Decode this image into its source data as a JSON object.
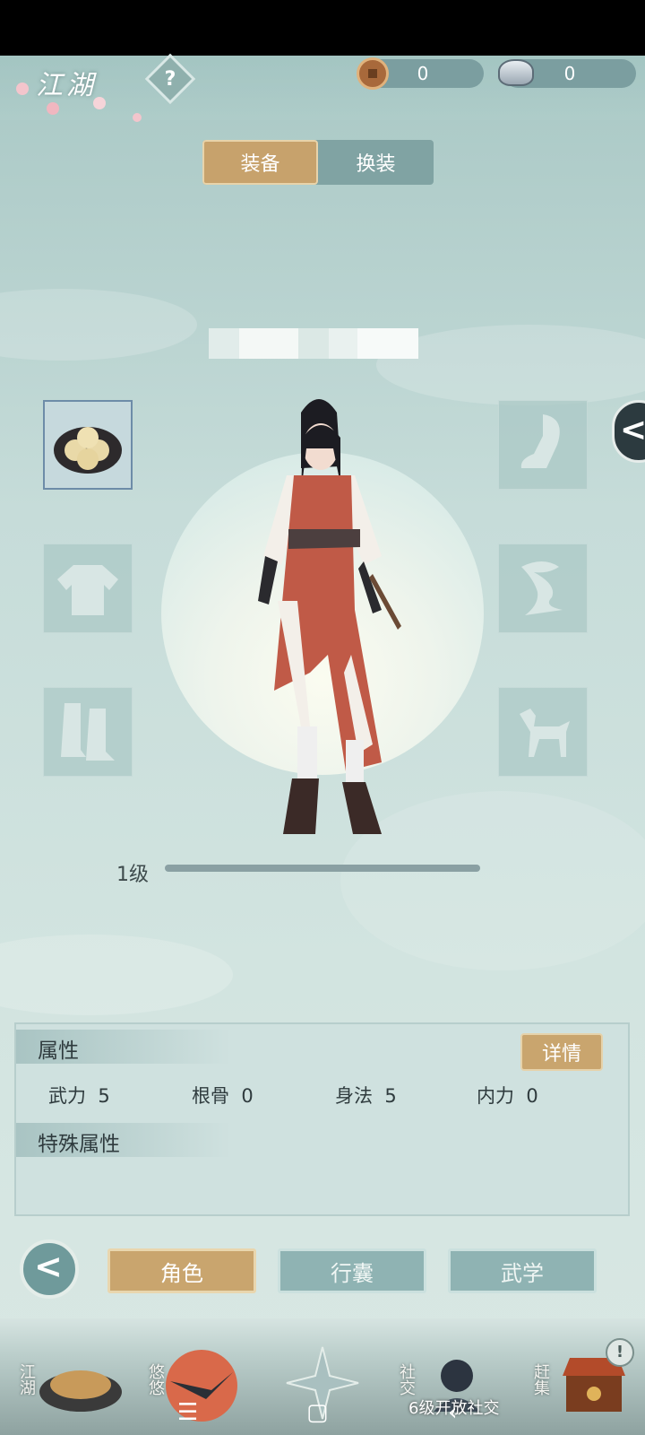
{
  "header": {
    "scene_title": "江湖",
    "help_label": "?",
    "currencies": [
      {
        "name": "copper-coin",
        "value": "0"
      },
      {
        "name": "silver-ingot",
        "value": "0"
      }
    ]
  },
  "tabs": [
    {
      "label": "装备",
      "active": true
    },
    {
      "label": "换装",
      "active": false
    }
  ],
  "equipment_slots": {
    "left": [
      "food-slot",
      "clothing-slot",
      "boots-slot"
    ],
    "right": [
      "weapon-slot",
      "accessory-slot",
      "mount-slot"
    ]
  },
  "side_toggle_label": "<",
  "level": {
    "label": "1级",
    "progress": 0.0
  },
  "attributes": {
    "title": "属性",
    "detail_label": "详情",
    "stats": [
      {
        "name": "武力",
        "value": "5"
      },
      {
        "name": "根骨",
        "value": "0"
      },
      {
        "name": "身法",
        "value": "5"
      },
      {
        "name": "内力",
        "value": "0"
      }
    ],
    "special_title": "特殊属性"
  },
  "bottom_nav": [
    {
      "label": "角色",
      "active": true
    },
    {
      "label": "行囊",
      "active": false
    },
    {
      "label": "武学",
      "active": false
    }
  ],
  "bottom_bar": {
    "items": [
      "江湖",
      "悠悠",
      "社交",
      "赶集"
    ],
    "unlock_notice": "6级开放社交"
  },
  "system_nav": {
    "menu": "☰",
    "home": "▢",
    "back": "‹"
  }
}
